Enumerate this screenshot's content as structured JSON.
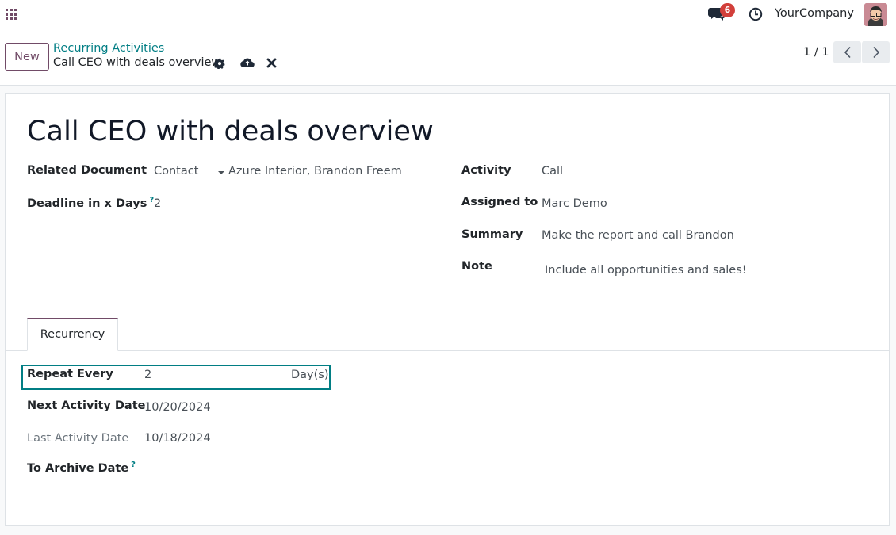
{
  "navbar": {
    "notification_count": "6",
    "company": "YourCompany"
  },
  "control": {
    "new_label": "New",
    "breadcrumb_parent": "Recurring Activities",
    "breadcrumb_current": "Call CEO with deals overview",
    "pager": "1 / 1"
  },
  "form": {
    "title": "Call CEO with deals overview",
    "related_document_label": "Related Document",
    "related_model": "Contact",
    "related_record": "Azure Interior, Brandon Freem",
    "deadline_label": "Deadline in x Days",
    "deadline_value": "2",
    "help_mark": "?",
    "activity_label": "Activity",
    "activity_value": "Call",
    "assigned_label": "Assigned to",
    "assigned_value": "Marc Demo",
    "summary_label": "Summary",
    "summary_value": "Make the report and call Brandon",
    "note_label": "Note",
    "note_value": "Include all opportunities and sales!"
  },
  "tabs": [
    {
      "label": "Recurrency"
    }
  ],
  "recurrency": {
    "repeat_label": "Repeat Every",
    "repeat_value": "2",
    "repeat_unit": "Day(s)",
    "next_label": "Next Activity Date",
    "next_value": "10/20/2024",
    "last_label": "Last Activity Date",
    "last_value": "10/18/2024",
    "archive_label": "To Archive Date"
  },
  "colors": {
    "brand": "#714b67",
    "accent": "#017e84",
    "badge": "#d23f3a"
  }
}
